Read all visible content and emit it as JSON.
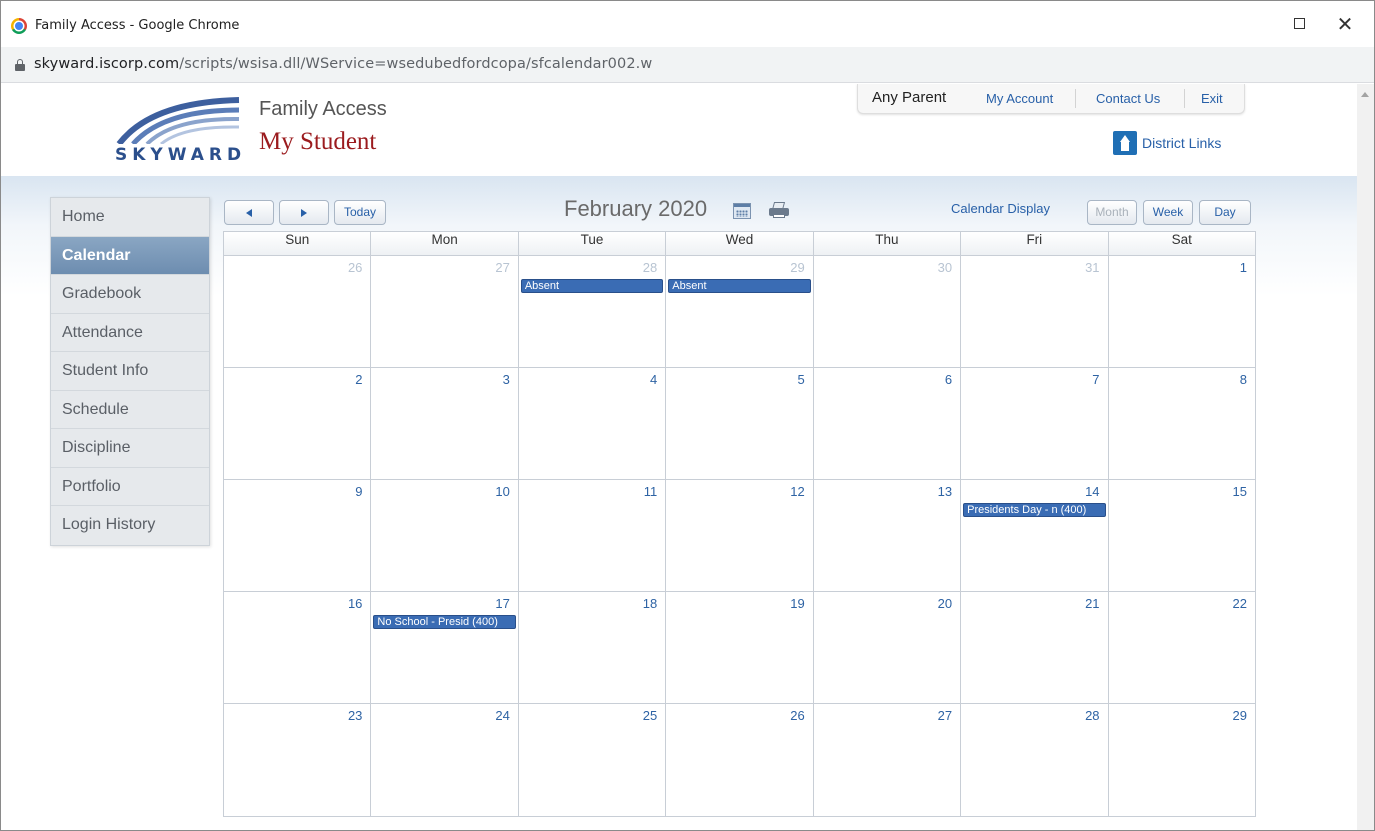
{
  "window": {
    "title": "Family Access - Google Chrome",
    "url_host": "skyward.iscorp.com",
    "url_path": "/scripts/wsisa.dll/WService=wsedubedfordcopa/sfcalendar002.w"
  },
  "header": {
    "logo_text": "SKYWARD",
    "app_title": "Family Access",
    "app_subtitle": "My Student",
    "user_name": "Any Parent",
    "my_account": "My Account",
    "contact_us": "Contact Us",
    "exit": "Exit",
    "district_links": "District Links"
  },
  "nav": {
    "items": [
      {
        "label": "Home"
      },
      {
        "label": "Calendar",
        "active": true
      },
      {
        "label": "Gradebook"
      },
      {
        "label": "Attendance"
      },
      {
        "label": "Student Info"
      },
      {
        "label": "Schedule"
      },
      {
        "label": "Discipline"
      },
      {
        "label": "Portfolio"
      },
      {
        "label": "Login History"
      }
    ]
  },
  "toolbar": {
    "today": "Today",
    "month_title": "February 2020",
    "calendar_display": "Calendar Display",
    "month": "Month",
    "week": "Week",
    "day": "Day"
  },
  "calendar": {
    "days_of_week": [
      "Sun",
      "Mon",
      "Tue",
      "Wed",
      "Thu",
      "Fri",
      "Sat"
    ],
    "weeks": [
      [
        {
          "num": "26",
          "other": true
        },
        {
          "num": "27",
          "other": true
        },
        {
          "num": "28",
          "other": true,
          "event": "Absent"
        },
        {
          "num": "29",
          "other": true,
          "event": "Absent"
        },
        {
          "num": "30",
          "other": true
        },
        {
          "num": "31",
          "other": true
        },
        {
          "num": "1"
        }
      ],
      [
        {
          "num": "2"
        },
        {
          "num": "3"
        },
        {
          "num": "4"
        },
        {
          "num": "5"
        },
        {
          "num": "6"
        },
        {
          "num": "7"
        },
        {
          "num": "8"
        }
      ],
      [
        {
          "num": "9"
        },
        {
          "num": "10"
        },
        {
          "num": "11"
        },
        {
          "num": "12"
        },
        {
          "num": "13"
        },
        {
          "num": "14",
          "event": "Presidents Day - n (400)"
        },
        {
          "num": "15"
        }
      ],
      [
        {
          "num": "16"
        },
        {
          "num": "17",
          "event": "No School - Presid (400)"
        },
        {
          "num": "18"
        },
        {
          "num": "19"
        },
        {
          "num": "20"
        },
        {
          "num": "21"
        },
        {
          "num": "22"
        }
      ],
      [
        {
          "num": "23"
        },
        {
          "num": "24"
        },
        {
          "num": "25"
        },
        {
          "num": "26"
        },
        {
          "num": "27"
        },
        {
          "num": "28"
        },
        {
          "num": "29"
        }
      ]
    ]
  }
}
